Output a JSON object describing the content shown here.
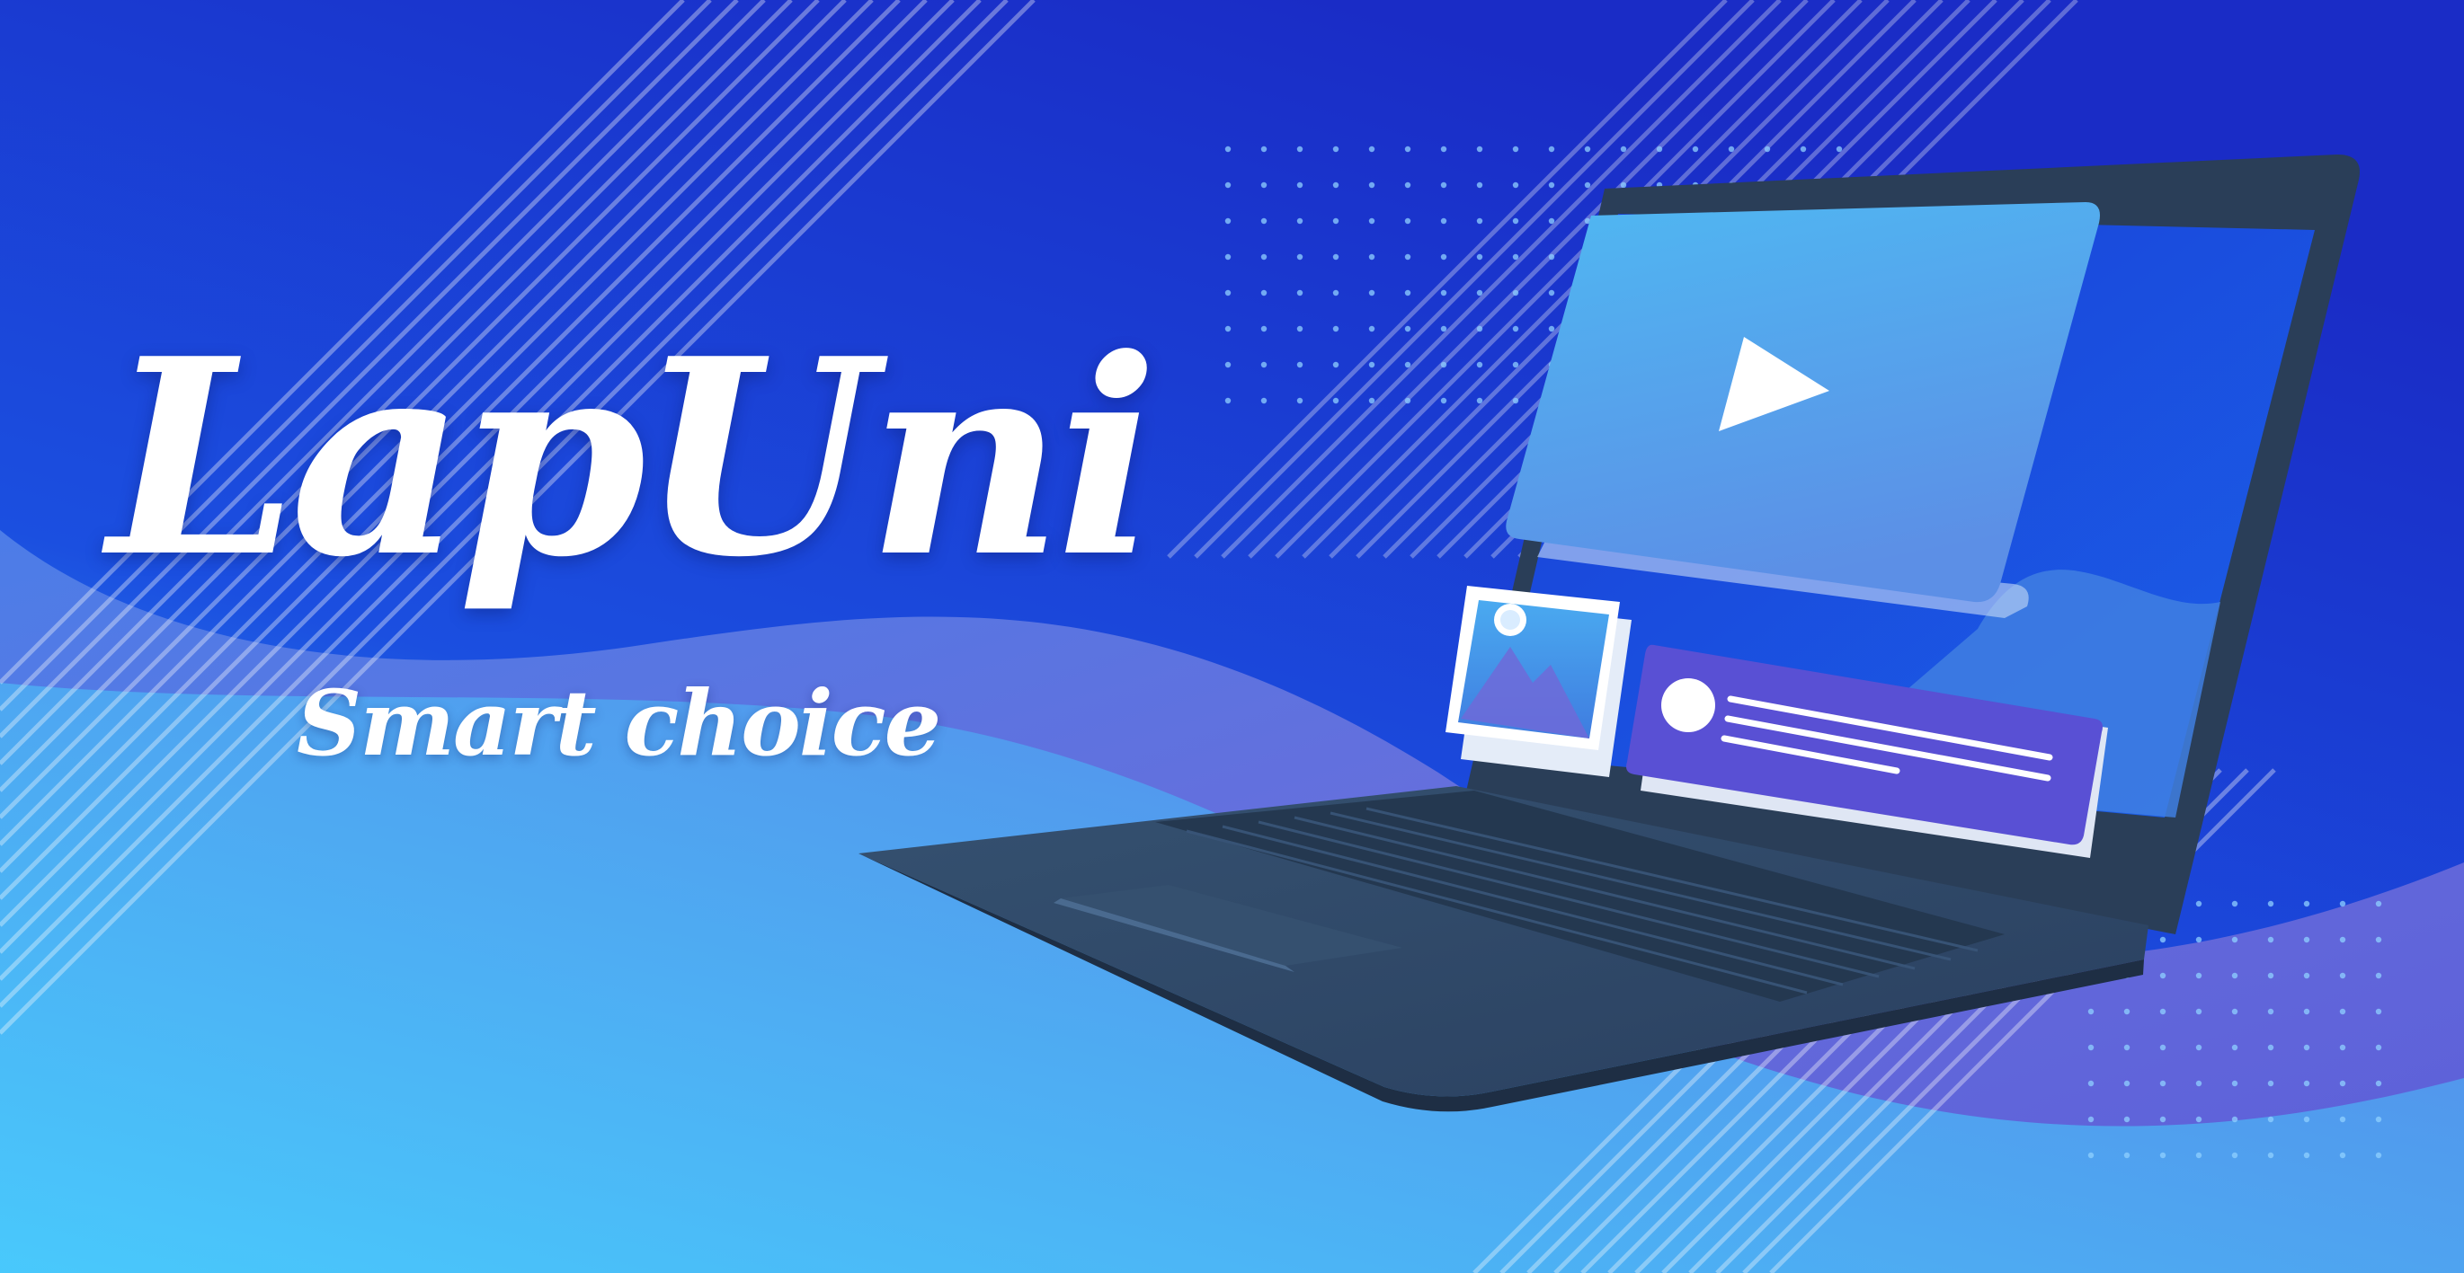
{
  "brand": {
    "name": "LapUni",
    "tagline": "Smart choice"
  },
  "colors": {
    "background_top": "#1b2fc8",
    "background_bottom": "#47d3ff",
    "wave_purple": "#5a62d8",
    "laptop_body": "#2d4563",
    "laptop_dark": "#1f2f45",
    "screen_blue": "#1e54e0",
    "card_blue": "#4fb6f0",
    "card_purple": "#5a52d6",
    "text": "#ffffff"
  },
  "icons": [
    "play-icon",
    "image-icon",
    "avatar-icon"
  ]
}
